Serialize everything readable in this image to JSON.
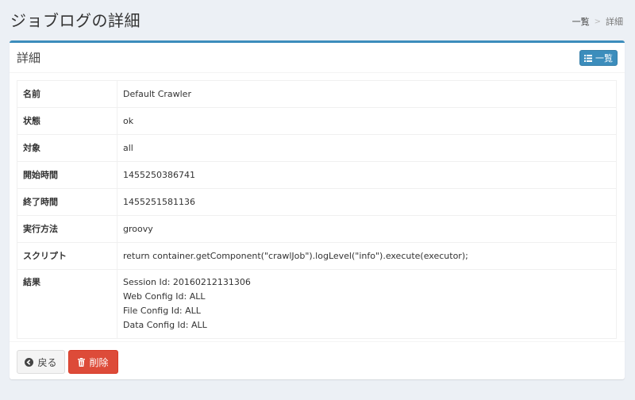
{
  "header": {
    "title": "ジョブログの詳細",
    "breadcrumb": {
      "link": "一覧",
      "separator": ">",
      "active": "詳細"
    }
  },
  "box": {
    "title": "詳細",
    "list_button_label": "一覧"
  },
  "details": {
    "name": {
      "label": "名前",
      "value": "Default Crawler"
    },
    "status": {
      "label": "状態",
      "value": "ok"
    },
    "target": {
      "label": "対象",
      "value": "all"
    },
    "start_time": {
      "label": "開始時間",
      "value": "1455250386741"
    },
    "end_time": {
      "label": "終了時間",
      "value": "1455251581136"
    },
    "exec_method": {
      "label": "実行方法",
      "value": "groovy"
    },
    "script": {
      "label": "スクリプト",
      "value": "return container.getComponent(\"crawlJob\").logLevel(\"info\").execute(executor);"
    },
    "result": {
      "label": "結果",
      "lines": [
        "Session Id: 20160212131306",
        "Web Config Id: ALL",
        "File Config Id: ALL",
        "Data Config Id: ALL"
      ]
    }
  },
  "footer": {
    "back_label": "戻る",
    "delete_label": "削除"
  },
  "icons": {
    "list": "list-icon",
    "back": "circle-arrow-left-icon",
    "delete": "trash-icon"
  },
  "colors": {
    "accent": "#3c8dbc",
    "danger": "#dd4b39",
    "background": "#ecf0f5"
  }
}
